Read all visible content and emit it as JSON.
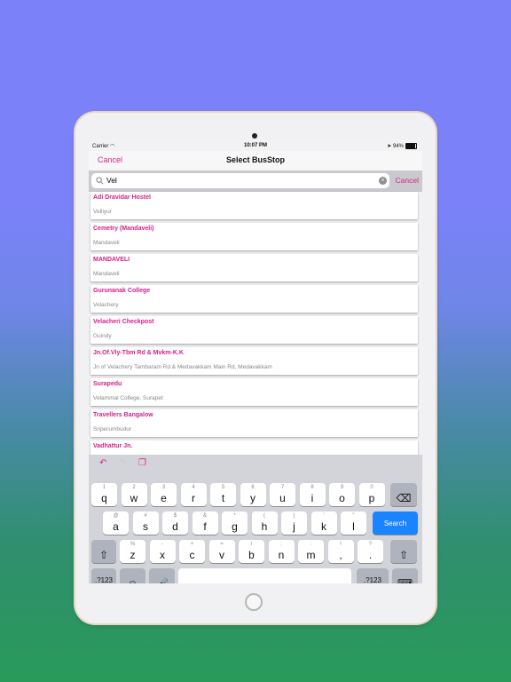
{
  "status": {
    "carrier": "Carrier",
    "time": "10:07 PM",
    "battery": "94%"
  },
  "nav": {
    "cancel": "Cancel",
    "title": "Select BusStop"
  },
  "search": {
    "value": "Vel",
    "cancel": "Cancel"
  },
  "results": [
    {
      "name": "Adi Dravidar Hostel",
      "area": "Velliyur"
    },
    {
      "name": "Cemetry (Mandaveli)",
      "area": "Mandaveli"
    },
    {
      "name": "MANDAVELI",
      "area": "Mandaveli"
    },
    {
      "name": "Gurunanak College",
      "area": "Velachery"
    },
    {
      "name": "Velacheri Checkpost",
      "area": "Guindy"
    },
    {
      "name": "Jn.Of.Vly-Tbm Rd & Mvkm-K.K",
      "area": "Jn of Velachery Tambaram Rd & Medavakkam Main Rd, Medavakkam"
    },
    {
      "name": "Surapedu",
      "area": "Velammal College, Surapet"
    },
    {
      "name": "Travellers Bangalow",
      "area": "Sriperumbudur"
    },
    {
      "name": "Vadhattur Jn.",
      "area": ""
    }
  ],
  "keyboard": {
    "row1": [
      [
        "1",
        "q"
      ],
      [
        "2",
        "w"
      ],
      [
        "3",
        "e"
      ],
      [
        "4",
        "r"
      ],
      [
        "5",
        "t"
      ],
      [
        "6",
        "y"
      ],
      [
        "7",
        "u"
      ],
      [
        "8",
        "i"
      ],
      [
        "9",
        "o"
      ],
      [
        "0",
        "p"
      ]
    ],
    "row2": [
      [
        "@",
        "a"
      ],
      [
        "#",
        "s"
      ],
      [
        "$",
        "d"
      ],
      [
        "&",
        "f"
      ],
      [
        "*",
        "g"
      ],
      [
        "(",
        "h"
      ],
      [
        ")",
        "j"
      ],
      [
        "'",
        "k"
      ],
      [
        "\"",
        "l"
      ]
    ],
    "row3": [
      [
        "%",
        "z"
      ],
      [
        "-",
        "x"
      ],
      [
        "+",
        "c"
      ],
      [
        "=",
        "v"
      ],
      [
        "/",
        "b"
      ],
      [
        ";",
        "n"
      ],
      [
        ":",
        "m"
      ],
      [
        "!",
        ","
      ],
      [
        "?",
        "."
      ]
    ],
    "search_label": "Search",
    "numbers_label": ".?123"
  }
}
